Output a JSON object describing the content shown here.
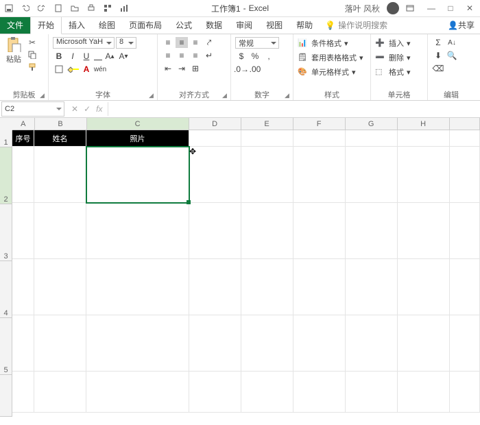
{
  "title": {
    "doc": "工作簿1",
    "app": "Excel",
    "user": "落叶 风秋"
  },
  "qat": [
    "save",
    "undo",
    "redo",
    "new",
    "open",
    "print",
    "addin",
    "chart"
  ],
  "win": {
    "min": "—",
    "max": "□",
    "close": "✕"
  },
  "tabs": {
    "file": "文件",
    "list": [
      "开始",
      "插入",
      "绘图",
      "页面布局",
      "公式",
      "数据",
      "审阅",
      "视图",
      "帮助"
    ],
    "tell": "操作说明搜索",
    "share": "共享"
  },
  "ribbon": {
    "clipboard": {
      "label": "剪贴板",
      "paste": "粘贴"
    },
    "font": {
      "label": "字体",
      "name": "Microsoft YaH",
      "size": "8"
    },
    "align": {
      "label": "对齐方式"
    },
    "number": {
      "label": "数字",
      "format": "常规"
    },
    "styles": {
      "label": "样式",
      "cond": "条件格式",
      "tbl": "套用表格格式",
      "cell": "单元格样式"
    },
    "cells": {
      "label": "单元格",
      "ins": "插入",
      "del": "删除",
      "fmt": "格式"
    },
    "editing": {
      "label": "编辑"
    }
  },
  "namebox": "C2",
  "tableHeaders": [
    "序号",
    "姓名",
    "照片"
  ],
  "cols": [
    {
      "l": "A",
      "w": 32
    },
    {
      "l": "B",
      "w": 76
    },
    {
      "l": "C",
      "w": 150
    },
    {
      "l": "D",
      "w": 76
    },
    {
      "l": "E",
      "w": 76
    },
    {
      "l": "F",
      "w": 76
    },
    {
      "l": "G",
      "w": 76
    },
    {
      "l": "H",
      "w": 76
    },
    {
      "l": "",
      "w": 44
    }
  ],
  "rows": [
    {
      "n": "1",
      "h": 24
    },
    {
      "n": "2",
      "h": 82
    },
    {
      "n": "3",
      "h": 82
    },
    {
      "n": "4",
      "h": 82
    },
    {
      "n": "5",
      "h": 82
    },
    {
      "n": "",
      "h": 60
    }
  ]
}
